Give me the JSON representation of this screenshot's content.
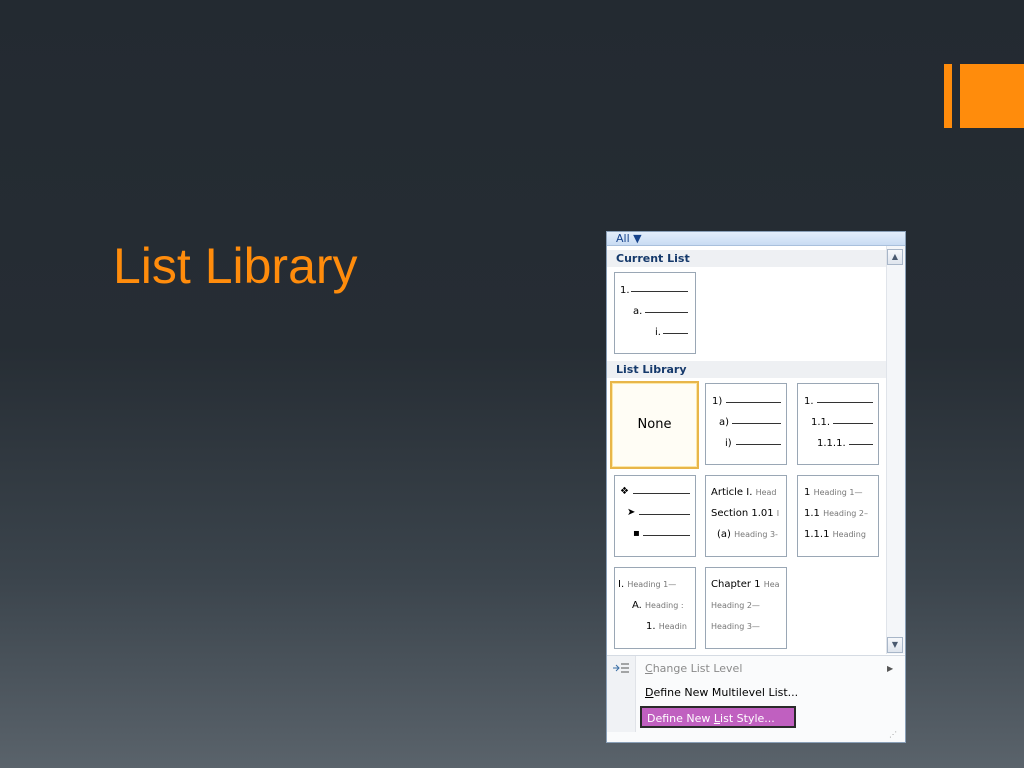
{
  "slide": {
    "title": "List Library"
  },
  "gallery": {
    "filter_label": "All ▼",
    "current_list": {
      "heading": "Current List",
      "levels": [
        "1.",
        "a.",
        "i."
      ]
    },
    "list_library": {
      "heading": "List Library",
      "none_label": "None",
      "numbered_paren": [
        "1)",
        "a)",
        "i)"
      ],
      "numbered_decimal": [
        "1.",
        "1.1.",
        "1.1.1."
      ],
      "bullets": [
        "❖",
        "➤",
        "▪"
      ],
      "article": [
        {
          "lead": "Article I.",
          "tail": "Head"
        },
        {
          "lead": "Section 1.01",
          "tail": "I"
        },
        {
          "lead": "(a)",
          "tail": "Heading 3-"
        }
      ],
      "heading_decimal": [
        {
          "lead": "1",
          "tail": "Heading 1—"
        },
        {
          "lead": "1.1",
          "tail": "Heading 2–"
        },
        {
          "lead": "1.1.1",
          "tail": "Heading"
        }
      ],
      "heading_roman": [
        {
          "lead": "I.",
          "tail": "Heading 1—"
        },
        {
          "lead": "A.",
          "tail": "Heading :"
        },
        {
          "lead": "1.",
          "tail": "Headin"
        }
      ],
      "chapter": [
        {
          "lead": "Chapter 1",
          "tail": "Hea"
        },
        {
          "lead": "",
          "tail": "Heading 2—"
        },
        {
          "lead": "",
          "tail": "Heading 3—"
        }
      ]
    },
    "menu": {
      "change_level": {
        "key": "C",
        "rest": "hange List Level"
      },
      "define_multilevel": {
        "key": "D",
        "rest": "efine New Multilevel List..."
      },
      "define_style": {
        "pre": "Define New ",
        "key": "L",
        "rest": "ist Style..."
      }
    }
  },
  "colors": {
    "accent": "#ff8c0c",
    "highlight": "#c060c0"
  }
}
